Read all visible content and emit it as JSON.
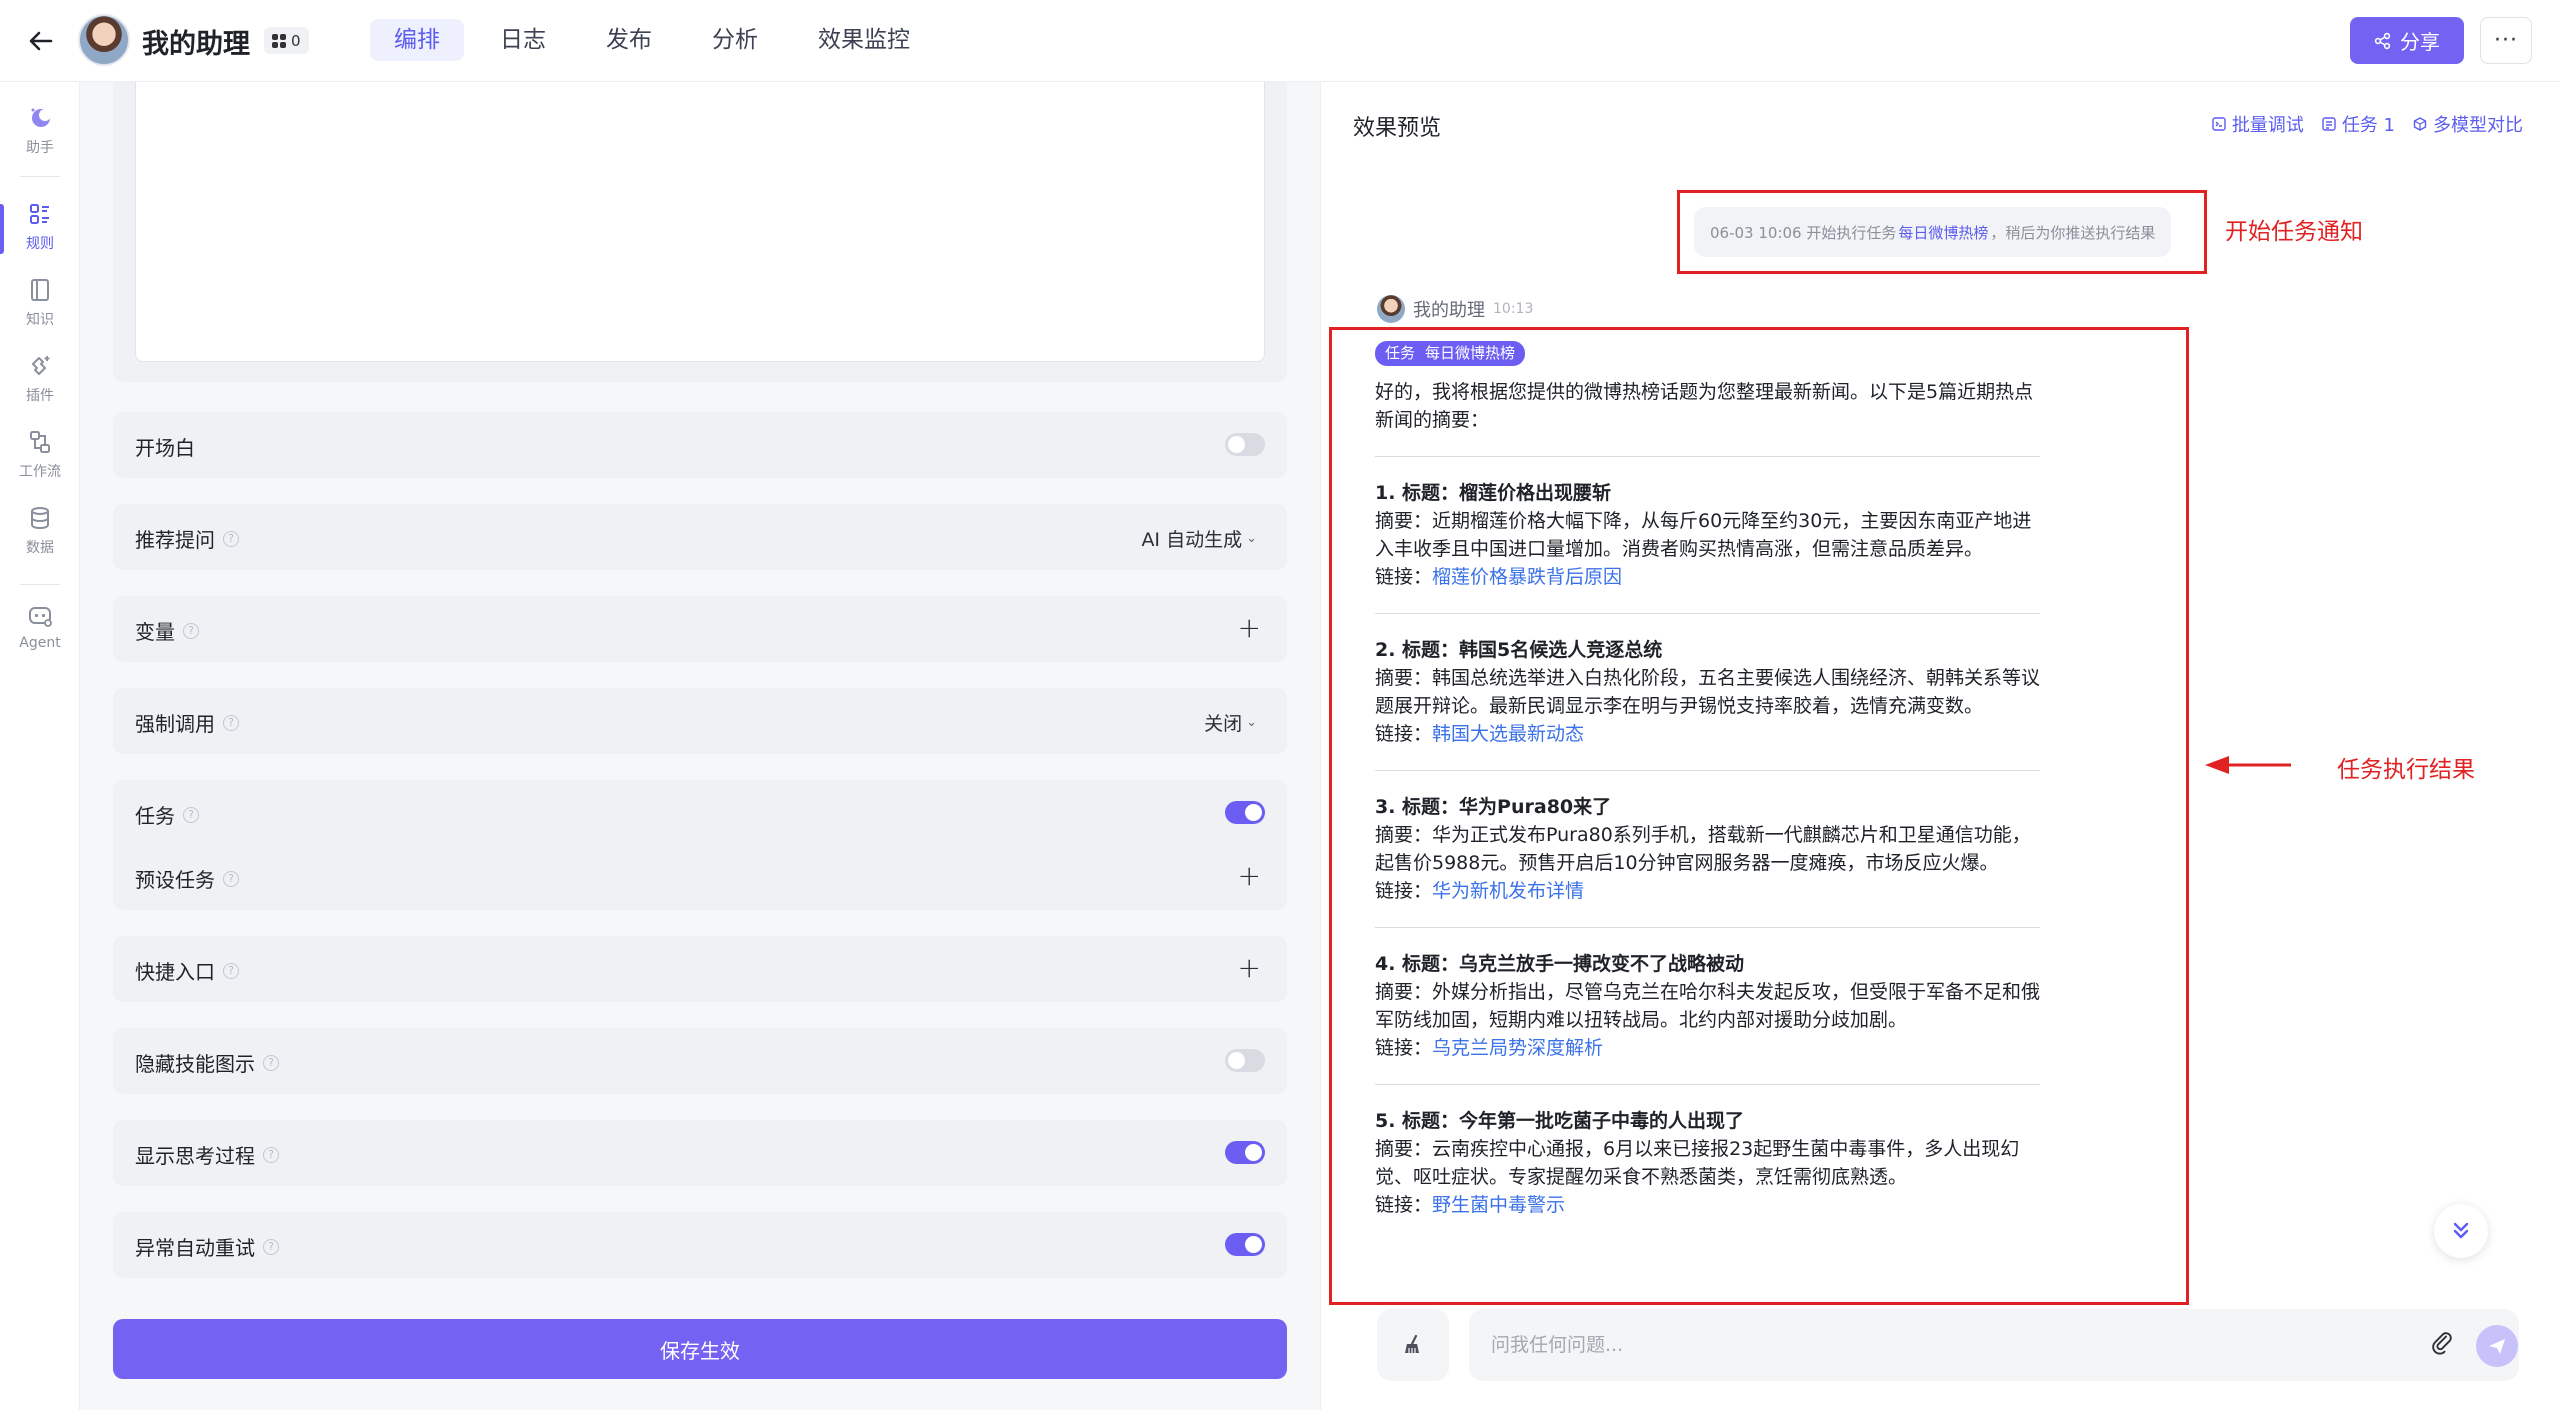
{
  "header": {
    "title": "我的助理",
    "badge_count": "0",
    "tabs": [
      "编排",
      "日志",
      "发布",
      "分析",
      "效果监控"
    ],
    "active_tab": "编排",
    "share_label": "分享",
    "more_label": "···"
  },
  "rail": {
    "items": [
      {
        "label": "助手",
        "icon": "assistant-icon"
      },
      {
        "label": "规则",
        "icon": "rules-icon",
        "active": true
      },
      {
        "label": "知识",
        "icon": "knowledge-icon"
      },
      {
        "label": "插件",
        "icon": "plugin-icon"
      },
      {
        "label": "工作流",
        "icon": "workflow-icon"
      },
      {
        "label": "数据",
        "icon": "database-icon"
      },
      {
        "label": "Agent",
        "icon": "agent-icon"
      }
    ]
  },
  "config": {
    "opening": {
      "label": "开场白",
      "enabled": false
    },
    "suggest": {
      "label": "推荐提问",
      "value": "AI 自动生成"
    },
    "variables": {
      "label": "变量"
    },
    "force_call": {
      "label": "强制调用",
      "value": "关闭"
    },
    "tasks": {
      "label": "任务",
      "enabled": true
    },
    "preset_tasks": {
      "label": "预设任务"
    },
    "shortcut": {
      "label": "快捷入口"
    },
    "hide_skill": {
      "label": "隐藏技能图示",
      "enabled": false
    },
    "show_thinking": {
      "label": "显示思考过程",
      "enabled": true
    },
    "auto_retry": {
      "label": "异常自动重试",
      "enabled": true
    },
    "save_label": "保存生效"
  },
  "preview": {
    "title": "效果预览",
    "actions": [
      "批量调试",
      "任务 1",
      "多模型对比"
    ],
    "notice": {
      "prefix": "06-03 10:06  开始执行任务",
      "task_name": "每日微博热榜",
      "suffix": "，稍后为你推送执行结果"
    },
    "callouts": {
      "start": "开始任务通知",
      "result": "任务执行结果"
    },
    "bot": {
      "name": "我的助理",
      "time": "10:13"
    },
    "task_tag": {
      "label": "任务",
      "name": "每日微博热榜"
    },
    "intro": "好的，我将根据您提供的微博热榜话题为您整理最新新闻。以下是5篇近期热点新闻的摘要：",
    "news": [
      {
        "title": "1. 标题：榴莲价格出现腰斩",
        "summary": "摘要：近期榴莲价格大幅下降，从每斤60元降至约30元，主要因东南亚产地进入丰收季且中国进口量增加。消费者购买热情高涨，但需注意品质差异。",
        "link_label": "链接：",
        "link_text": "榴莲价格暴跌背后原因"
      },
      {
        "title": "2. 标题：韩国5名候选人竞逐总统",
        "summary": "摘要：韩国总统选举进入白热化阶段，五名主要候选人围绕经济、朝韩关系等议题展开辩论。最新民调显示李在明与尹锡悦支持率胶着，选情充满变数。",
        "link_label": "链接：",
        "link_text": "韩国大选最新动态"
      },
      {
        "title": "3. 标题：华为Pura80来了",
        "summary": "摘要：华为正式发布Pura80系列手机，搭载新一代麒麟芯片和卫星通信功能，起售价5988元。预售开启后10分钟官网服务器一度瘫痪，市场反应火爆。",
        "link_label": "链接：",
        "link_text": "华为新机发布详情"
      },
      {
        "title": "4. 标题：乌克兰放手一搏改变不了战略被动",
        "summary": "摘要：外媒分析指出，尽管乌克兰在哈尔科夫发起反攻，但受限于军备不足和俄军防线加固，短期内难以扭转战局。北约内部对援助分歧加剧。",
        "link_label": "链接：",
        "link_text": "乌克兰局势深度解析"
      },
      {
        "title": "5. 标题：今年第一批吃菌子中毒的人出现了",
        "summary": "摘要：云南疾控中心通报，6月以来已接报23起野生菌中毒事件，多人出现幻觉、呕吐症状。专家提醒勿采食不熟悉菌类，烹饪需彻底熟透。",
        "link_label": "链接：",
        "link_text": "野生菌中毒警示"
      }
    ],
    "input_placeholder": "问我任何问题..."
  },
  "colors": {
    "accent": "#7462f3",
    "annotation": "#e02222",
    "link": "#3b72e8"
  }
}
